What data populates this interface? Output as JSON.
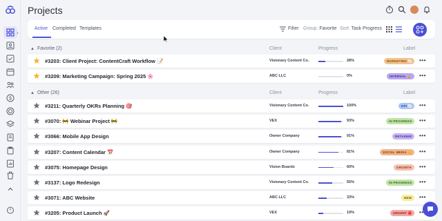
{
  "app": {
    "title": "Projects"
  },
  "toolbar": {
    "tabs": [
      "Active",
      "Completed",
      "Templates"
    ],
    "filter_label": "Filter",
    "group_prefix": "Group:",
    "group_value": "Favorite",
    "sort_prefix": "Sort:",
    "sort_value": "Task Progress"
  },
  "columns": {
    "client": "Client",
    "progress": "Progress",
    "label": "Label"
  },
  "groups": [
    {
      "name": "Favorite (2)"
    },
    {
      "name": "Other (26)"
    }
  ],
  "favorite_rows": [
    {
      "title": "#3203: Client Project: ContentCraft Workflow 📝",
      "client": "Visionary Content Co.",
      "progress": "28%",
      "progress_value": 0.28,
      "label": "MARKETING 📈",
      "label_color": "#f2c28a",
      "label_text_color": "#7a4a12"
    },
    {
      "title": "#3209: Marketing Campaign: Spring 2025 🌸",
      "client": "ABC LLC",
      "progress": "0%",
      "progress_value": 0,
      "label": "INTERNAL 🔒",
      "label_color": "#b9a6f0",
      "label_text_color": "#4a2f8f"
    }
  ],
  "other_rows": [
    {
      "title": "#3211: Quarterly OKRs Planning 🎯",
      "client": "Visionary Content Co.",
      "progress": "100%",
      "progress_value": 1,
      "label": "KPI 📈",
      "label_color": "#a9c6f5",
      "label_text_color": "#23488a"
    },
    {
      "title": "#3070: 🚧 Webinar Project 🚧",
      "client": "VEX",
      "progress": "93%",
      "progress_value": 0.93,
      "label": "IN PROGRESS",
      "label_color": "#bfe3a8",
      "label_text_color": "#3a6a1f"
    },
    {
      "title": "#3066: Mobile App Design",
      "client": "Owner Company",
      "progress": "91%",
      "progress_value": 0.91,
      "label": "RETAINER",
      "label_color": "#c4b4f2",
      "label_text_color": "#4a2f8f"
    },
    {
      "title": "#3207: Content Calendar 📅",
      "client": "Owner Company",
      "progress": "81%",
      "progress_value": 0.81,
      "label": "SOCIAL MEDIA 😊",
      "label_color": "#f2b48a",
      "label_text_color": "#7a3a12"
    },
    {
      "title": "#3075: Homepage Design",
      "client": "Vision Boards",
      "progress": "60%",
      "progress_value": 0.6,
      "label": "GROWTH",
      "label_color": "#f5c2b0",
      "label_text_color": "#8a3a1f"
    },
    {
      "title": "#3137: Logo Redesign",
      "client": "Visionary Content Co.",
      "progress": "55%",
      "progress_value": 0.55,
      "label": "IN PROGRESS",
      "label_color": "#bfe3a8",
      "label_text_color": "#3a6a1f"
    },
    {
      "title": "#3071: ABC Website",
      "client": "ABC LLC",
      "progress": "33%",
      "progress_value": 0.33,
      "label": "NEW",
      "label_color": "#f7ee9c",
      "label_text_color": "#6a5e0f"
    },
    {
      "title": "#3205: Product Launch 🚀",
      "client": "VEX",
      "progress": "19%",
      "progress_value": 0.19,
      "label": "URGENT 🔴",
      "label_color": "#f4a5a5",
      "label_text_color": "#8a1f1f"
    }
  ],
  "icons": {
    "logo": "logo-icon",
    "timer": "timer-icon",
    "search": "search-icon",
    "avatar": "avatar",
    "bell": "bell-icon",
    "star": "star-icon",
    "more": "more-icon",
    "chat": "chat-icon"
  },
  "colors": {
    "accent": "#4a4fd6",
    "favorite_star": "#f2b632",
    "other_star": "#6b6f80"
  }
}
